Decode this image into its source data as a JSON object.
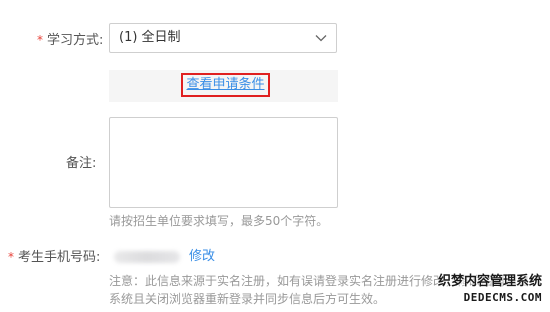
{
  "form": {
    "study_mode": {
      "required_mark": "*",
      "label": "学习方式:",
      "selected_value": "(1) 全日制"
    },
    "conditions_link": "查看申请条件",
    "remark": {
      "label": "备注:",
      "value": "",
      "hint": "请按招生单位要求填写，最多50个字符。"
    },
    "phone": {
      "required_mark": "*",
      "label": "考生手机号码:",
      "edit_link": "修改"
    },
    "notice": {
      "line1": "注意：此信息来源于实名注册，如有误请登录实名注册进行修改，修改后请退出",
      "line2": "系统且关闭浏览器重新登录并同步信息后方可生效。"
    }
  },
  "watermark": {
    "line1": "织梦内容管理系统",
    "line2": "DEDECMS.COM"
  },
  "colors": {
    "required": "#e8433a",
    "link": "#3a8ee6",
    "highlight_border": "#e02020",
    "hint_text": "#999999"
  }
}
